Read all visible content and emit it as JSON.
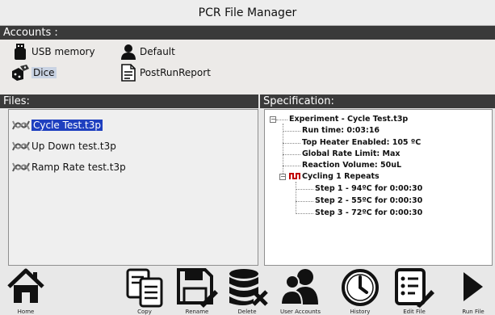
{
  "window": {
    "title": "PCR File Manager"
  },
  "accounts": {
    "header": "Accounts :",
    "items": [
      {
        "label": "USB memory",
        "icon": "usb-drive-icon",
        "selected": false
      },
      {
        "label": "Default",
        "icon": "user-icon",
        "selected": false
      },
      {
        "label": "Dice",
        "icon": "dice-icon",
        "selected": true
      },
      {
        "label": "PostRunReport",
        "icon": "document-icon",
        "selected": false
      }
    ]
  },
  "files": {
    "header": "Files:",
    "items": [
      {
        "label": "Cycle Test.t3p",
        "icon": "dna-file-icon",
        "selected": true
      },
      {
        "label": "Up Down test.t3p",
        "icon": "dna-file-icon",
        "selected": false
      },
      {
        "label": "Ramp Rate test.t3p",
        "icon": "dna-file-icon",
        "selected": false
      }
    ]
  },
  "specification": {
    "header": "Specification:",
    "root": "Experiment - Cycle Test.t3p",
    "details": [
      "Run time: 0:03:16",
      "Top Heater Enabled: 105 ºC",
      "Global Rate Limit: Max",
      "Reaction Volume: 50uL"
    ],
    "cycling": "Cycling 1 Repeats",
    "steps": [
      "Step 1 - 94ºC for 0:00:30",
      "Step 2 - 55ºC for 0:00:30",
      "Step 3 - 72ºC for 0:00:30"
    ],
    "collapse_glyph": "−"
  },
  "toolbar": {
    "items": [
      {
        "label": "Home",
        "icon": "home-icon"
      },
      {
        "label": "Copy",
        "icon": "copy-icon"
      },
      {
        "label": "Rename",
        "icon": "save-rename-icon"
      },
      {
        "label": "Delete",
        "icon": "database-delete-icon"
      },
      {
        "label": "User Accounts",
        "icon": "users-icon"
      },
      {
        "label": "History",
        "icon": "clock-icon"
      },
      {
        "label": "Edit File",
        "icon": "edit-list-icon"
      },
      {
        "label": "Run File",
        "icon": "play-icon"
      }
    ]
  },
  "colors": {
    "section_bar": "#3a3a3a",
    "file_selection": "#1e3fbf",
    "cycling_icon": "#c00000"
  }
}
